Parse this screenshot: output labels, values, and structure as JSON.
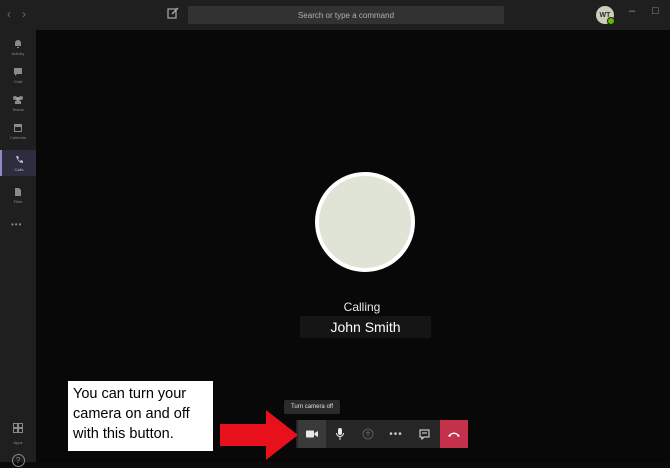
{
  "topbar": {
    "back_glyph": "‹",
    "forward_glyph": "›",
    "search_placeholder": "Search or type a command",
    "avatar_initials": "WT",
    "minimize_glyph": "–",
    "maximize_glyph": "□"
  },
  "rail": {
    "items": [
      {
        "label": "Activity",
        "icon": "bell-icon"
      },
      {
        "label": "Chat",
        "icon": "chat-icon"
      },
      {
        "label": "Teams",
        "icon": "teams-icon"
      },
      {
        "label": "Calendar",
        "icon": "calendar-icon"
      },
      {
        "label": "Calls",
        "icon": "phone-icon"
      },
      {
        "label": "Files",
        "icon": "files-icon"
      }
    ],
    "more": "•••",
    "apps_label": "Apps",
    "help_glyph": "?"
  },
  "call": {
    "status": "Calling",
    "contact_name": "John Smith"
  },
  "tooltip": "Turn camera off",
  "controls": {
    "more_glyph": "•••"
  },
  "annotation": {
    "lines": [
      "You can turn your",
      "camera on and off",
      "with this button."
    ]
  },
  "colors": {
    "hangup": "#c4314b",
    "arrow": "#e8101a",
    "presence": "#6bb700"
  }
}
